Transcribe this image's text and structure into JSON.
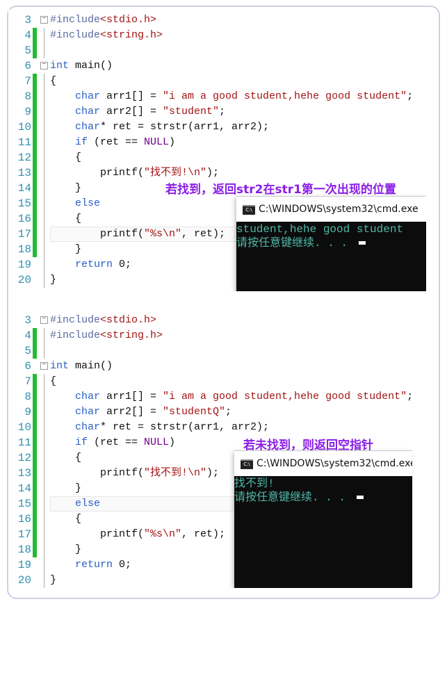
{
  "panels": [
    {
      "code": [
        {
          "n": "3",
          "fold": true,
          "bar": false,
          "t": [
            [
              "pp",
              "#include"
            ],
            [
              "str",
              "<stdio.h>"
            ]
          ]
        },
        {
          "n": "4",
          "bar": true,
          "t": [
            [
              "pp",
              "#include"
            ],
            [
              "str",
              "<string.h>"
            ]
          ]
        },
        {
          "n": "5",
          "bar": true,
          "t": []
        },
        {
          "n": "6",
          "fold": true,
          "t": [
            [
              "kw",
              "int"
            ],
            [
              "txt",
              " main()"
            ]
          ]
        },
        {
          "n": "7",
          "bar": true,
          "t": [
            [
              "txt",
              "{"
            ]
          ]
        },
        {
          "n": "8",
          "bar": true,
          "t": [
            [
              "kw",
              "    char"
            ],
            [
              "txt",
              " arr1[] = "
            ],
            [
              "str",
              "\"i am a good student,hehe good student\""
            ],
            [
              "txt",
              ";"
            ]
          ]
        },
        {
          "n": "9",
          "bar": true,
          "t": [
            [
              "kw",
              "    char"
            ],
            [
              "txt",
              " arr2[] = "
            ],
            [
              "str",
              "\"student\""
            ],
            [
              "txt",
              ";"
            ]
          ]
        },
        {
          "n": "10",
          "bar": true,
          "t": [
            [
              "kw",
              "    char"
            ],
            [
              "txt",
              "* ret = strstr(arr1, arr2);"
            ]
          ]
        },
        {
          "n": "11",
          "bar": true,
          "t": [
            [
              "kw",
              "    if"
            ],
            [
              "txt",
              " (ret == "
            ],
            [
              "mac",
              "NULL"
            ],
            [
              "txt",
              ")"
            ]
          ]
        },
        {
          "n": "12",
          "bar": true,
          "t": [
            [
              "txt",
              "    {"
            ]
          ]
        },
        {
          "n": "13",
          "bar": true,
          "t": [
            [
              "txt",
              "        printf("
            ],
            [
              "str",
              "\"找不到!\\n\""
            ],
            [
              "txt",
              ");"
            ]
          ]
        },
        {
          "n": "14",
          "bar": true,
          "t": [
            [
              "txt",
              "    }"
            ]
          ]
        },
        {
          "n": "15",
          "bar": true,
          "t": [
            [
              "kw",
              "    else"
            ]
          ]
        },
        {
          "n": "16",
          "bar": true,
          "t": [
            [
              "txt",
              "    {"
            ]
          ]
        },
        {
          "n": "17",
          "bar": true,
          "hl": true,
          "t": [
            [
              "txt",
              "        printf("
            ],
            [
              "str",
              "\"%s\\n\""
            ],
            [
              "txt",
              ", ret);"
            ]
          ]
        },
        {
          "n": "18",
          "bar": true,
          "t": [
            [
              "txt",
              "    }"
            ]
          ]
        },
        {
          "n": "19",
          "t": [
            [
              "kw",
              "    return"
            ],
            [
              "txt",
              " 0;"
            ]
          ]
        },
        {
          "n": "20",
          "t": [
            [
              "txt",
              "}"
            ]
          ]
        }
      ],
      "note": "若找到，返回str2在str1第一次出现的位置",
      "cmd": {
        "title": "C:\\WINDOWS\\system32\\cmd.exe",
        "output": [
          "student,hehe good student",
          "请按任意键继续. . . "
        ]
      }
    },
    {
      "code": [
        {
          "n": "3",
          "fold": true,
          "t": [
            [
              "pp",
              "#include"
            ],
            [
              "str",
              "<stdio.h>"
            ]
          ]
        },
        {
          "n": "4",
          "bar": true,
          "t": [
            [
              "pp",
              "#include"
            ],
            [
              "str",
              "<string.h>"
            ]
          ]
        },
        {
          "n": "5",
          "bar": true,
          "t": []
        },
        {
          "n": "6",
          "fold": true,
          "t": [
            [
              "kw",
              "int"
            ],
            [
              "txt",
              " main()"
            ]
          ]
        },
        {
          "n": "7",
          "bar": true,
          "t": [
            [
              "txt",
              "{"
            ]
          ]
        },
        {
          "n": "8",
          "bar": true,
          "t": [
            [
              "kw",
              "    char"
            ],
            [
              "txt",
              " arr1[] = "
            ],
            [
              "str",
              "\"i am a good student,hehe good student\""
            ],
            [
              "txt",
              ";"
            ]
          ]
        },
        {
          "n": "9",
          "bar": true,
          "t": [
            [
              "kw",
              "    char"
            ],
            [
              "txt",
              " arr2[] = "
            ],
            [
              "str",
              "\"studentQ\""
            ],
            [
              "txt",
              ";"
            ]
          ]
        },
        {
          "n": "10",
          "bar": true,
          "t": [
            [
              "kw",
              "    char"
            ],
            [
              "txt",
              "* ret = strstr(arr1, arr2);"
            ]
          ]
        },
        {
          "n": "11",
          "bar": true,
          "t": [
            [
              "kw",
              "    if"
            ],
            [
              "txt",
              " (ret == "
            ],
            [
              "mac",
              "NULL"
            ],
            [
              "txt",
              ")"
            ]
          ]
        },
        {
          "n": "12",
          "bar": true,
          "t": [
            [
              "txt",
              "    {"
            ]
          ]
        },
        {
          "n": "13",
          "bar": true,
          "t": [
            [
              "txt",
              "        printf("
            ],
            [
              "str",
              "\"找不到!\\n\""
            ],
            [
              "txt",
              ");"
            ]
          ]
        },
        {
          "n": "14",
          "bar": true,
          "t": [
            [
              "txt",
              "    }"
            ]
          ]
        },
        {
          "n": "15",
          "bar": true,
          "hl": true,
          "t": [
            [
              "kw",
              "    else"
            ]
          ]
        },
        {
          "n": "16",
          "bar": true,
          "t": [
            [
              "txt",
              "    {"
            ]
          ]
        },
        {
          "n": "17",
          "bar": true,
          "t": [
            [
              "txt",
              "        printf("
            ],
            [
              "str",
              "\"%s\\n\""
            ],
            [
              "txt",
              ", ret);"
            ]
          ]
        },
        {
          "n": "18",
          "bar": true,
          "t": [
            [
              "txt",
              "    }"
            ]
          ]
        },
        {
          "n": "19",
          "t": [
            [
              "kw",
              "    return"
            ],
            [
              "txt",
              " 0;"
            ]
          ]
        },
        {
          "n": "20",
          "t": [
            [
              "txt",
              "}"
            ]
          ]
        }
      ],
      "note": "若未找到，则返回空指针",
      "cmd": {
        "title": "C:\\WINDOWS\\system32\\cmd.exe",
        "output": [
          "找不到!",
          "请按任意键继续. . . "
        ]
      }
    }
  ],
  "colors": {
    "keyword": "#2a5fc8",
    "string": "#a31515",
    "macro": "#6f008a",
    "line_number": "#2b91af",
    "change_bar": "#22bb33",
    "note": "#8a1ee8",
    "terminal_text": "#4fb8a8"
  }
}
